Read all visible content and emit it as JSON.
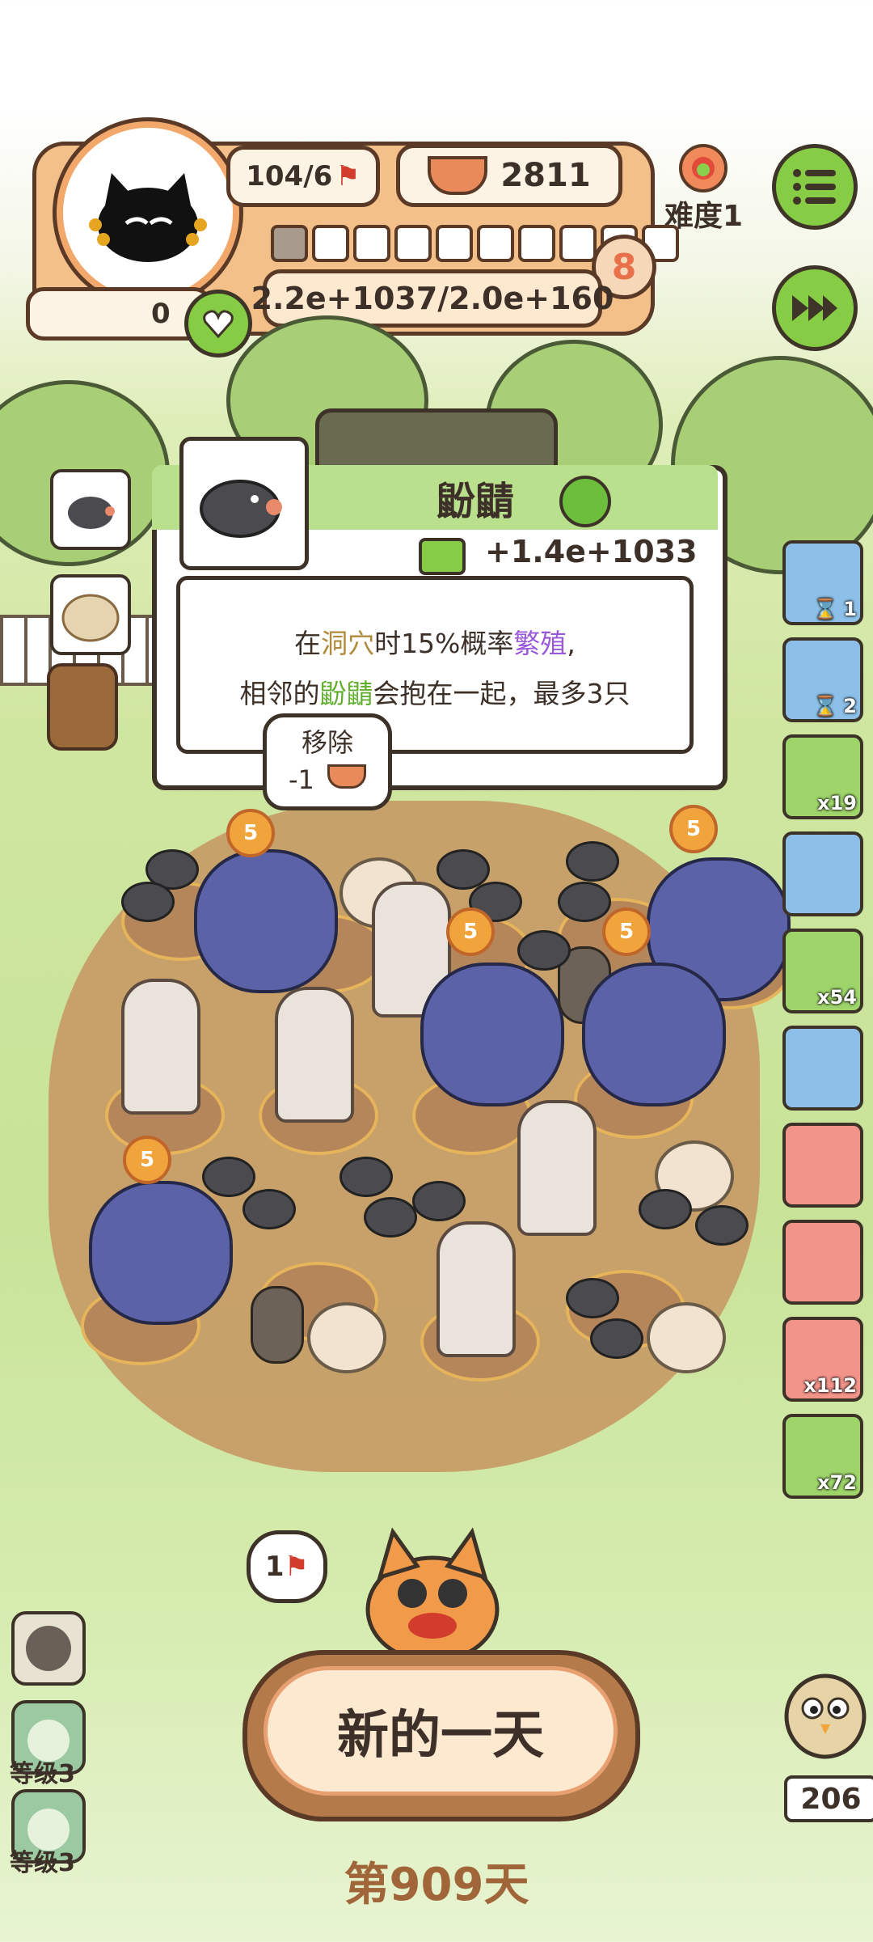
{
  "hud": {
    "population": "104/6",
    "food_count": "2811",
    "difficulty_label": "难度1",
    "level_number": "8",
    "progress_filled_slots": 1,
    "progress_total_slots": 10,
    "score_text": "2.2e+1037/2.0e+160",
    "heart_count": "0"
  },
  "left_thumbs": [
    "mole-thumb",
    "nest-thumb"
  ],
  "tooltip": {
    "creature_name": "鼢鼱",
    "bonus_text": "+1.4e+1033",
    "desc_line1_pre": "在",
    "desc_line1_cave": "洞穴",
    "desc_line1_mid": "时15%概率",
    "desc_line1_breed": "繁殖",
    "desc_line1_post": ",",
    "desc_line2_pre": "相邻的",
    "desc_line2_mole": "鼢鼱",
    "desc_line2_post": "会抱在一起，最多3只"
  },
  "remove_bubble": {
    "label": "移除",
    "cost": "-1"
  },
  "sidebar": [
    {
      "icon": "shovel-hourglass-icon",
      "count": "1",
      "color": "blue"
    },
    {
      "icon": "shovel-hourglass-icon",
      "count": "2",
      "color": "blue"
    },
    {
      "icon": "worm-icon",
      "count": "x19",
      "color": "green"
    },
    {
      "icon": "hut-icon",
      "count": "",
      "color": "blue"
    },
    {
      "icon": "tent-icon",
      "count": "x54",
      "color": "green"
    },
    {
      "icon": "wig-icon",
      "count": "",
      "color": "blue"
    },
    {
      "icon": "heart-necklace-icon",
      "count": "",
      "color": "red"
    },
    {
      "icon": "rope-icon",
      "count": "",
      "color": "red"
    },
    {
      "icon": "crystal-icon",
      "count": "x112",
      "color": "red"
    },
    {
      "icon": "refresh-ticket-icon",
      "count": "x72",
      "color": "green"
    }
  ],
  "flag_bubble": "1",
  "level_items": [
    {
      "label": ""
    },
    {
      "label": "等级3"
    },
    {
      "label": "等级3"
    }
  ],
  "bottom": {
    "new_day_label": "新的一天",
    "day_counter": "第909天",
    "chick_count": "206"
  },
  "colors": {
    "accent_green": "#86cc45",
    "hud_orange": "#f4c08a",
    "outline": "#5a3a26"
  }
}
